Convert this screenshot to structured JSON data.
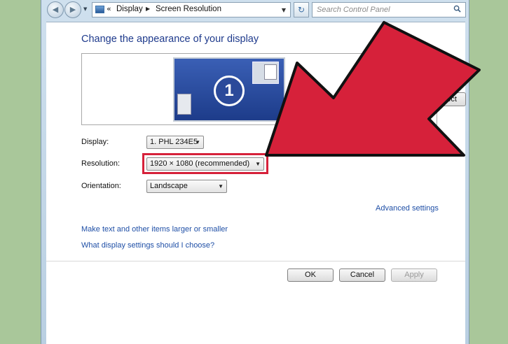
{
  "addressbar": {
    "history_glyph": "«",
    "crumbs": [
      "Display",
      "Screen Resolution"
    ],
    "search_placeholder": "Search Control Panel"
  },
  "main": {
    "title": "Change the appearance of your display",
    "monitor_number": "1",
    "detect_label": "Detect",
    "display_label": "Display:",
    "display_value": "1. PHL 234E5",
    "resolution_label": "Resolution:",
    "resolution_value": "1920 × 1080 (recommended)",
    "orientation_label": "Orientation:",
    "orientation_value": "Landscape",
    "advanced_link": "Advanced settings",
    "text_size_link": "Make text and other items larger or smaller",
    "help_link": "What display settings should I choose?"
  },
  "buttons": {
    "ok": "OK",
    "cancel": "Cancel",
    "apply": "Apply"
  },
  "colors": {
    "annotation_arrow": "#d6213a",
    "link": "#1f4fa6",
    "title": "#1e3a8c"
  }
}
